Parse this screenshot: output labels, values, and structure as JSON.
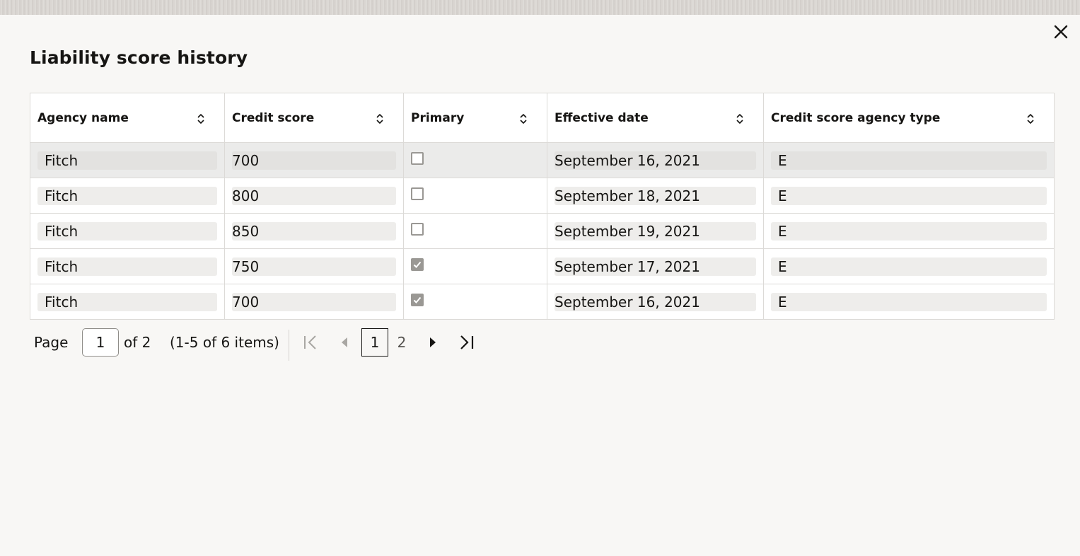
{
  "dialog": {
    "title": "Liability score history",
    "close_icon": "close-icon"
  },
  "table": {
    "columns": [
      {
        "label": "Agency name"
      },
      {
        "label": "Credit score"
      },
      {
        "label": "Primary"
      },
      {
        "label": "Effective date"
      },
      {
        "label": "Credit score agency type"
      }
    ],
    "rows": [
      {
        "agency": "Fitch",
        "score": "700",
        "primary": false,
        "date": "September 16, 2021",
        "type": "E"
      },
      {
        "agency": "Fitch",
        "score": "800",
        "primary": false,
        "date": "September 18, 2021",
        "type": "E"
      },
      {
        "agency": "Fitch",
        "score": "850",
        "primary": false,
        "date": "September 19, 2021",
        "type": "E"
      },
      {
        "agency": "Fitch",
        "score": "750",
        "primary": true,
        "date": "September 17, 2021",
        "type": "E"
      },
      {
        "agency": "Fitch",
        "score": "700",
        "primary": true,
        "date": "September 16, 2021",
        "type": "E"
      }
    ]
  },
  "pagination": {
    "page_label": "Page",
    "current_page": "1",
    "of_label": "of 2",
    "range_label": "(1-5 of 6 items)",
    "pages": [
      "1",
      "2"
    ]
  }
}
